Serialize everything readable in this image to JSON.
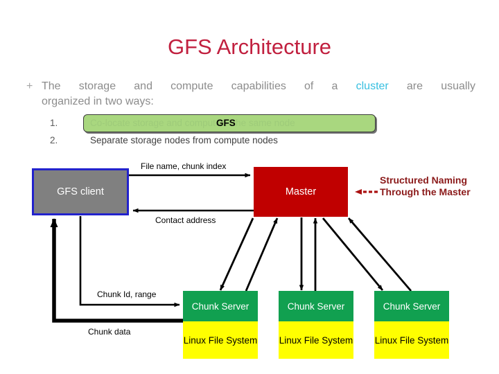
{
  "slide": {
    "title": "GFS Architecture",
    "title_color": "#c1203f"
  },
  "bullet": {
    "marker": "+",
    "line1_pre": "The storage and compute capabilities of a ",
    "keyword": "cluster",
    "keyword_color": "#36bfe0",
    "line1_post": " are usually",
    "line2": "organized in two ways:",
    "items": [
      {
        "number": "1.",
        "text": "Co-locate storage and compute in the same node"
      },
      {
        "number": "2.",
        "text": "Separate storage nodes from compute nodes"
      }
    ]
  },
  "callout": {
    "label": "GFS",
    "fill": "#a9d77f",
    "border": "#3c3c3c"
  },
  "diagram": {
    "client": {
      "label": "GFS client",
      "fill": "#808080",
      "border": "#2222cc"
    },
    "master": {
      "label": "Master",
      "fill": "#c00000"
    },
    "chunk_servers": [
      {
        "head": "Chunk Server",
        "body": "Linux File\nSystem"
      },
      {
        "head": "Chunk Server",
        "body": "Linux File\nSystem"
      },
      {
        "head": "Chunk Server",
        "body": "Linux File\nSystem"
      }
    ],
    "chunk_head_fill": "#11a050",
    "chunk_body_fill": "#ffff00",
    "edges": {
      "file_name": "File name, chunk index",
      "contact_address": "Contact address",
      "chunk_id": "Chunk Id, range",
      "chunk_data": "Chunk data"
    },
    "annotation": {
      "text": "Structured Naming\nThrough the Master",
      "color": "#8b1a1a"
    }
  }
}
